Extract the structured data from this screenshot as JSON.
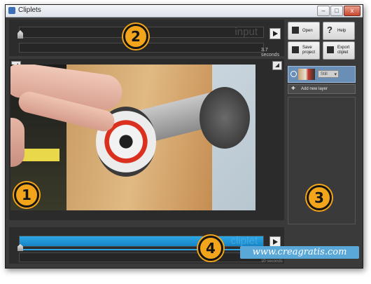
{
  "window": {
    "title": "Cliplets",
    "controls": {
      "minimize": "–",
      "maximize": "□",
      "close": "x"
    }
  },
  "input_panel": {
    "track_title": "input",
    "duration": "3.7 seconds"
  },
  "toolbar": {
    "open": "Open",
    "help": "Help",
    "save_project": "Save project",
    "export_cliplet": "Export cliplet",
    "icons": {
      "open": "folder-icon",
      "help": "question-icon",
      "save": "floppy-icon",
      "export": "camera-icon"
    }
  },
  "layers": {
    "items": [
      {
        "mode": "Still"
      }
    ],
    "add_new": "Add new layer",
    "add_icon": "+"
  },
  "cliplet_panel": {
    "track_title": "cliplet",
    "duration": "10 seconds"
  },
  "annotations": [
    "1",
    "2",
    "3",
    "4"
  ],
  "watermark": "www.creagratis.com",
  "colors": {
    "accent": "#f2a51a",
    "cliplet_blue": "#2da7e6",
    "panel": "#2c2c2c",
    "layer_selected": "#6a8fb6"
  }
}
